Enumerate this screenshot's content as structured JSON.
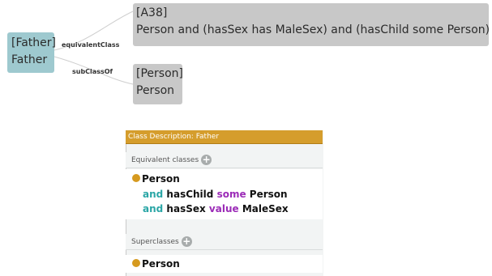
{
  "graph": {
    "father_node": {
      "label_bracket": "[Father]",
      "label_name": "Father"
    },
    "a38_node": {
      "label_bracket": "[A38]",
      "label_expression": "Person and (hasSex has MaleSex) and (hasChild some Person)"
    },
    "person_node": {
      "label_bracket": "[Person]",
      "label_name": "Person"
    },
    "edges": {
      "equivalent": "equivalentClass",
      "subclass": "subClassOf"
    }
  },
  "panel": {
    "title": "Class Description: Father",
    "equivalent_header": "Equivalent classes",
    "superclasses_header": "Superclasses",
    "add_symbol": "+",
    "equivalent_expression": {
      "root": "Person",
      "line1": {
        "op": "and",
        "property": "hasChild",
        "quantifier": "some",
        "filler": "Person"
      },
      "line2": {
        "op": "and",
        "property": "hasSex",
        "quantifier": "value",
        "filler": "MaleSex"
      }
    },
    "superclass": "Person"
  },
  "colors": {
    "named_class_node": "#9ec9cf",
    "expression_node": "#c8c8c8",
    "panel_title_bar": "#d59d2c",
    "class_bullet": "#d69a1f",
    "keyword_teal": "#2aa6a6",
    "keyword_purple": "#9b2bb7"
  }
}
